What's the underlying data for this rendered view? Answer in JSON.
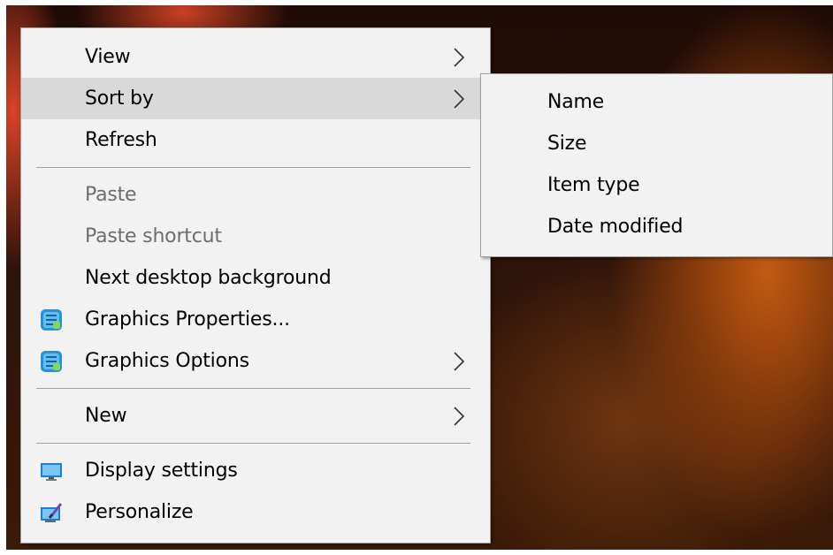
{
  "context_menu": {
    "items": [
      {
        "label": "View"
      },
      {
        "label": "Sort by"
      },
      {
        "label": "Refresh"
      },
      {
        "label": "Paste"
      },
      {
        "label": "Paste shortcut"
      },
      {
        "label": "Next desktop background"
      },
      {
        "label": "Graphics Properties..."
      },
      {
        "label": "Graphics Options"
      },
      {
        "label": "New"
      },
      {
        "label": "Display settings"
      },
      {
        "label": "Personalize"
      }
    ],
    "active_item": "Sort by",
    "disabled_items": [
      "Paste",
      "Paste shortcut"
    ]
  },
  "sort_submenu": {
    "items": [
      {
        "label": "Name"
      },
      {
        "label": "Size"
      },
      {
        "label": "Item type"
      },
      {
        "label": "Date modified"
      }
    ]
  },
  "icons": {
    "submenu_arrow": "chevron-right-icon",
    "graphics_properties": "intel-graphics-icon",
    "graphics_options": "intel-graphics-icon",
    "display_settings": "monitor-icon",
    "personalize": "personalize-icon"
  },
  "colors": {
    "menu_background": "#f2f2f2",
    "menu_border": "#a0a0a0",
    "hover_background": "#d9d9d9",
    "disabled_text": "#6d6d6d"
  }
}
